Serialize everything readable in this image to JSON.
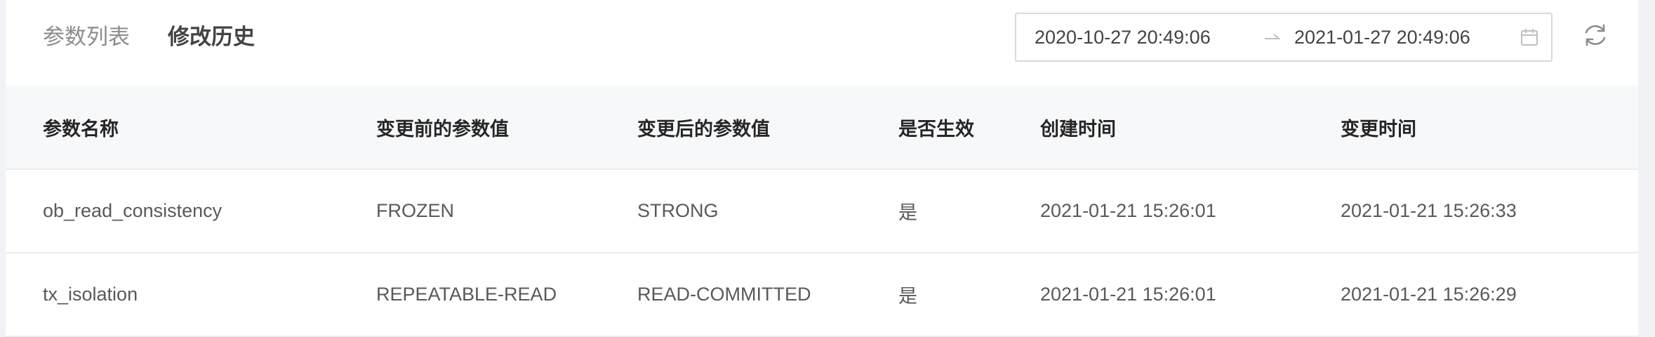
{
  "tabs": [
    {
      "label": "参数列表",
      "active": false
    },
    {
      "label": "修改历史",
      "active": true
    }
  ],
  "date_range": {
    "start": "2020-10-27 20:49:06",
    "end": "2021-01-27 20:49:06"
  },
  "icons": {
    "separator": "arrow-right-icon",
    "calendar": "calendar-icon",
    "refresh": "refresh-icon"
  },
  "table": {
    "columns": [
      "参数名称",
      "变更前的参数值",
      "变更后的参数值",
      "是否生效",
      "创建时间",
      "变更时间"
    ],
    "rows": [
      [
        "ob_read_consistency",
        "FROZEN",
        "STRONG",
        "是",
        "2021-01-21 15:26:01",
        "2021-01-21 15:26:33"
      ],
      [
        "tx_isolation",
        "REPEATABLE-READ",
        "READ-COMMITTED",
        "是",
        "2021-01-21 15:26:01",
        "2021-01-21 15:26:29"
      ]
    ]
  },
  "colors": {
    "active_tab": "#434343",
    "inactive_tab": "#8c8c8c",
    "header_bg": "#f7f8fa",
    "border": "#d9d9d9"
  }
}
